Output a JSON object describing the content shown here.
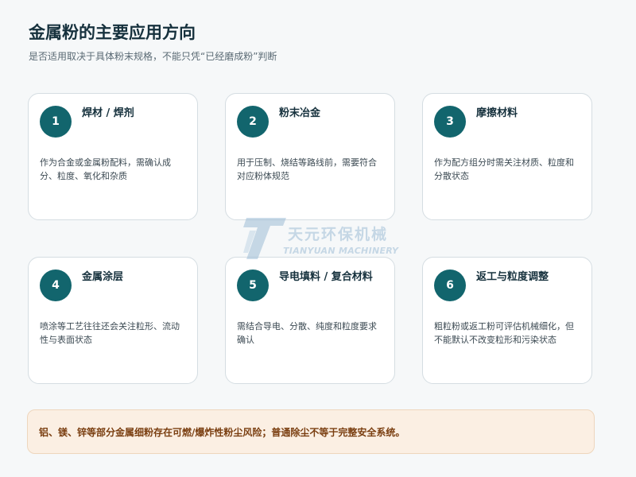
{
  "header": {
    "title": "金属粉的主要应用方向",
    "subtitle": "是否适用取决于具体粉末规格，不能只凭“已经磨成粉”判断"
  },
  "cards": [
    {
      "number": "1",
      "title": "焊材 / 焊剂",
      "description": "作为合金或金属粉配料，需确认成分、粒度、氧化和杂质"
    },
    {
      "number": "2",
      "title": "粉末冶金",
      "description": "用于压制、烧结等路线前，需要符合对应粉体规范"
    },
    {
      "number": "3",
      "title": "摩擦材料",
      "description": "作为配方组分时需关注材质、粒度和分散状态"
    },
    {
      "number": "4",
      "title": "金属涂层",
      "description": "喷涂等工艺往往还会关注粒形、流动性与表面状态"
    },
    {
      "number": "5",
      "title": "导电填料 / 复合材料",
      "description": "需结合导电、分散、纯度和粒度要求确认"
    },
    {
      "number": "6",
      "title": "返工与粒度调整",
      "description": "粗粒粉或返工粉可评估机械细化，但不能默认不改变粒形和污染状态"
    }
  ],
  "watermark": {
    "name_cn": "天元环保机械",
    "name_en": "TIANYUAN MACHINERY",
    "color": "#8ab0cf"
  },
  "warning": {
    "text": "铝、镁、锌等部分金属细粉存在可燃/爆炸性粉尘风险；普通除尘不等于完整安全系统。"
  },
  "colors": {
    "accent": "#12656d",
    "warning_bg": "#fbefe3",
    "warning_text": "#7a3e10"
  }
}
